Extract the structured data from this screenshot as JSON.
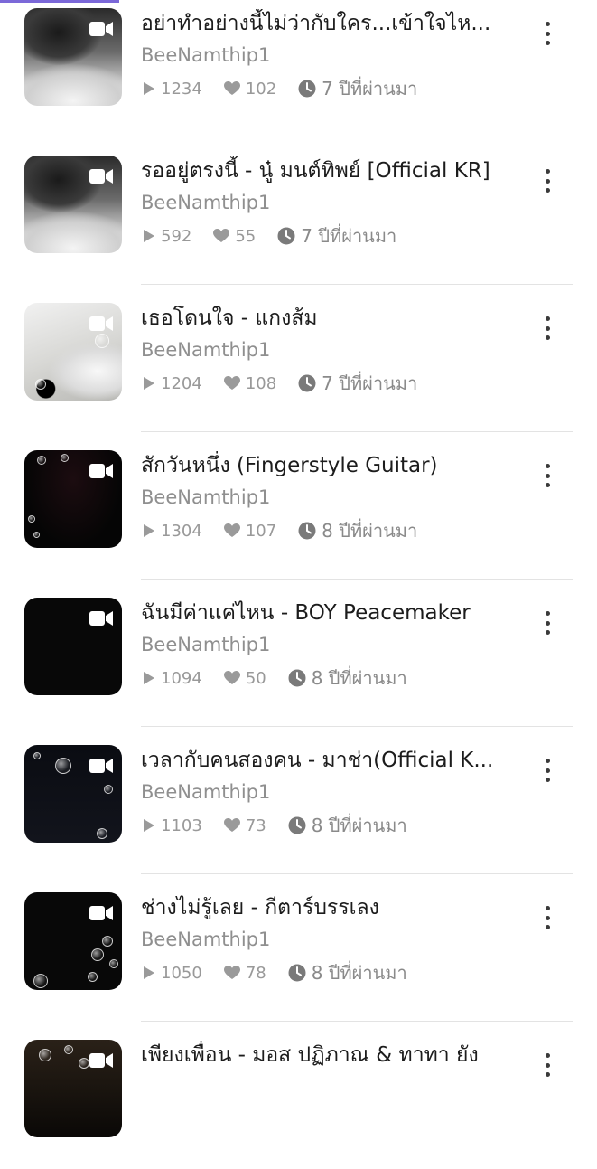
{
  "colors": {
    "accent": "#7b68d8",
    "title": "#1c1c1c",
    "meta": "#999999"
  },
  "icons": {
    "play": "play-icon",
    "like": "heart-icon",
    "age": "clock-icon",
    "video": "video-camera-icon",
    "more": "more-vertical-icon"
  },
  "tracks": [
    {
      "title": "อย่าทำอย่างนี้ไม่ว่ากับใคร...เข้าใจไห...",
      "author": "BeeNamthip1",
      "plays": "1234",
      "likes": "102",
      "age": "7 ปีที่ผ่านมา"
    },
    {
      "title": "รออยู่ตรงนี้ - นู๋ มนต์ทิพย์ [Official KR]",
      "author": "BeeNamthip1",
      "plays": "592",
      "likes": "55",
      "age": "7 ปีที่ผ่านมา"
    },
    {
      "title": "เธอโดนใจ - แกงส้ม",
      "author": "BeeNamthip1",
      "plays": "1204",
      "likes": "108",
      "age": "7 ปีที่ผ่านมา"
    },
    {
      "title": "สักวันหนึ่ง (Fingerstyle Guitar)",
      "author": "BeeNamthip1",
      "plays": "1304",
      "likes": "107",
      "age": "8 ปีที่ผ่านมา"
    },
    {
      "title": "ฉันมีค่าแค่ไหน - BOY Peacemaker",
      "author": "BeeNamthip1",
      "plays": "1094",
      "likes": "50",
      "age": "8 ปีที่ผ่านมา"
    },
    {
      "title": "เวลากับคนสองคน - มาช่า(Official K...",
      "author": "BeeNamthip1",
      "plays": "1103",
      "likes": "73",
      "age": "8 ปีที่ผ่านมา"
    },
    {
      "title": "ช่างไม่รู้เลย - กีตาร์บรรเลง",
      "author": "BeeNamthip1",
      "plays": "1050",
      "likes": "78",
      "age": "8 ปีที่ผ่านมา"
    },
    {
      "title": "เพียงเพื่อน - มอส ปฏิภาณ & ทาทา ยัง",
      "author": "",
      "plays": "",
      "likes": "",
      "age": ""
    }
  ]
}
